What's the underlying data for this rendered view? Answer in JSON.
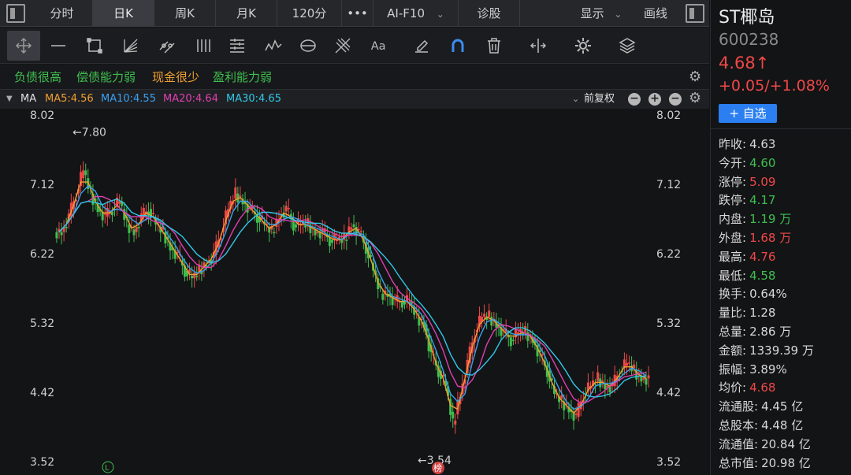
{
  "tabs": [
    {
      "label": "分时"
    },
    {
      "label": "日K"
    },
    {
      "label": "周K"
    },
    {
      "label": "月K"
    },
    {
      "label": "120分"
    },
    {
      "label": "•••"
    },
    {
      "label": "AI-F10"
    },
    {
      "label": "诊股"
    },
    {
      "label": "显示"
    },
    {
      "label": "画线"
    }
  ],
  "tags": [
    {
      "label": "负债很高",
      "color": "#3fbf4f"
    },
    {
      "label": "偿债能力弱",
      "color": "#3fbf4f"
    },
    {
      "label": "现金很少",
      "color": "#f0a030"
    },
    {
      "label": "盈利能力弱",
      "color": "#3fbf4f"
    }
  ],
  "ma": {
    "title": "MA",
    "ma5": "MA5:4.56",
    "ma10": "MA10:4.55",
    "ma20": "MA20:4.64",
    "ma30": "MA30:4.65",
    "adjust": "前复权",
    "colors": {
      "ma5": "#f0a030",
      "ma10": "#3aa0f0",
      "ma20": "#e040b0",
      "ma30": "#30c8e8"
    }
  },
  "chart_data": {
    "type": "candlestick",
    "y_ticks": [
      "8.02",
      "7.12",
      "6.22",
      "5.32",
      "4.42",
      "3.52"
    ],
    "ylim": [
      3.52,
      8.02
    ],
    "high_marker": "←7.80",
    "low_marker": "←3.54",
    "marker_L": "L",
    "marker_bang": "榜",
    "up_color": "#f04848",
    "down_color": "#3fbf4f",
    "closes": [
      6.5,
      6.7,
      7.0,
      7.3,
      7.0,
      6.8,
      6.7,
      6.8,
      6.9,
      6.6,
      6.5,
      6.7,
      6.8,
      6.6,
      6.5,
      6.3,
      6.2,
      6.0,
      5.9,
      6.0,
      6.1,
      6.2,
      6.5,
      6.8,
      7.0,
      6.9,
      6.8,
      6.7,
      6.6,
      6.5,
      6.7,
      6.8,
      6.6,
      6.6,
      6.6,
      6.5,
      6.5,
      6.4,
      6.4,
      6.4,
      6.6,
      6.5,
      6.3,
      6.0,
      5.7,
      5.7,
      5.6,
      5.6,
      5.6,
      5.4,
      5.3,
      4.9,
      4.7,
      4.5,
      4.0,
      4.4,
      4.8,
      5.2,
      5.4,
      5.4,
      5.3,
      5.2,
      5.1,
      5.2,
      5.2,
      5.1,
      4.9,
      4.7,
      4.4,
      4.3,
      4.2,
      4.1,
      4.4,
      4.5,
      4.6,
      4.5,
      4.5,
      4.7,
      4.8,
      4.7,
      4.6,
      4.6
    ],
    "x_dates_count": 82
  },
  "panel": {
    "name": "ST椰岛",
    "code": "600238",
    "price": "4.68↑",
    "change": "+0.05/+1.08%",
    "watch": "+ 自选",
    "stats": [
      {
        "k": "昨收:",
        "v": "4.63",
        "color": "#d8d8d8"
      },
      {
        "k": "今开:",
        "v": "4.60",
        "color": "#3fbf4f"
      },
      {
        "k": "涨停:",
        "v": "5.09",
        "color": "#f04848"
      },
      {
        "k": "跌停:",
        "v": "4.17",
        "color": "#3fbf4f"
      },
      {
        "k": "内盘:",
        "v": "1.19 万",
        "color": "#3fbf4f"
      },
      {
        "k": "外盘:",
        "v": "1.68 万",
        "color": "#f04848"
      },
      {
        "k": "最高:",
        "v": "4.76",
        "color": "#f04848"
      },
      {
        "k": "最低:",
        "v": "4.58",
        "color": "#3fbf4f"
      },
      {
        "k": "换手:",
        "v": "0.64%",
        "color": "#d8d8d8"
      },
      {
        "k": "量比:",
        "v": "1.28",
        "color": "#d8d8d8"
      },
      {
        "k": "总量:",
        "v": "2.86 万",
        "color": "#d8d8d8"
      },
      {
        "k": "金额:",
        "v": "1339.39 万",
        "color": "#d8d8d8"
      },
      {
        "k": "振幅:",
        "v": "3.89%",
        "color": "#d8d8d8"
      },
      {
        "k": "均价:",
        "v": "4.68",
        "color": "#f04848"
      },
      {
        "k": "流通股:",
        "v": "4.45 亿",
        "color": "#d8d8d8"
      },
      {
        "k": "总股本:",
        "v": "4.48 亿",
        "color": "#d8d8d8"
      },
      {
        "k": "流通值:",
        "v": "20.84 亿",
        "color": "#d8d8d8"
      },
      {
        "k": "总市值:",
        "v": "20.98 亿",
        "color": "#d8d8d8"
      }
    ]
  },
  "icons": [
    "crosshair-icon",
    "line-icon",
    "rect-icon",
    "fan-icon",
    "parallel-icon",
    "vertical-lines-icon",
    "text-box-icon",
    "wave-icon",
    "cycle-icon",
    "fib-icon",
    "text-icon",
    "pen-icon",
    "magnet-icon",
    "trash-icon",
    "compare-icon",
    "settings-icon",
    "layers-icon"
  ]
}
